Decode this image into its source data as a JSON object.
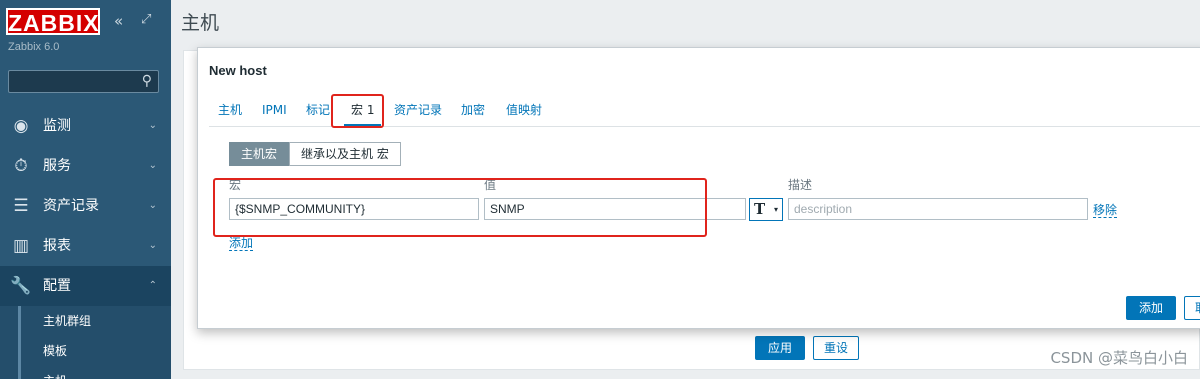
{
  "brand": {
    "logo_text": "ZABBIX",
    "version": "Zabbix 6.0"
  },
  "sidebar": {
    "collapse_icon": "«",
    "expand_icon": "⤢",
    "search": {
      "value": "",
      "placeholder": ""
    },
    "items": [
      {
        "label": "监测",
        "icon": "eye-icon"
      },
      {
        "label": "服务",
        "icon": "clock-icon"
      },
      {
        "label": "资产记录",
        "icon": "list-icon"
      },
      {
        "label": "报表",
        "icon": "chart-icon"
      },
      {
        "label": "配置",
        "icon": "wrench-icon"
      }
    ],
    "subitems": [
      {
        "label": "主机群组"
      },
      {
        "label": "模板"
      },
      {
        "label": "主机"
      }
    ]
  },
  "page": {
    "title": "主机"
  },
  "dialog": {
    "title": "New host",
    "tabs": [
      {
        "label": "主机"
      },
      {
        "label": "IPMI"
      },
      {
        "label": "标记"
      },
      {
        "label": "宏",
        "count": "1"
      },
      {
        "label": "资产记录"
      },
      {
        "label": "加密"
      },
      {
        "label": "值映射"
      }
    ],
    "subtabs": [
      {
        "label": "主机宏"
      },
      {
        "label": "继承以及主机 宏"
      }
    ],
    "columns": {
      "macro": "宏",
      "value": "值",
      "description": "描述"
    },
    "row": {
      "macro": "{$SNMP_COMMUNITY}",
      "value": "SNMP",
      "type_symbol": "T",
      "description_placeholder": "description",
      "remove_label": "移除"
    },
    "add_link": "添加",
    "add_button": "添加",
    "cancel_button": "取"
  },
  "footer": {
    "apply_button": "应用",
    "reset_button": "重设"
  },
  "watermark": "CSDN @菜鸟白小白",
  "colors": {
    "accent": "#0275b8",
    "annotation": "#e0241c",
    "sidebar": "#2b5876",
    "logo": "#d40000"
  }
}
